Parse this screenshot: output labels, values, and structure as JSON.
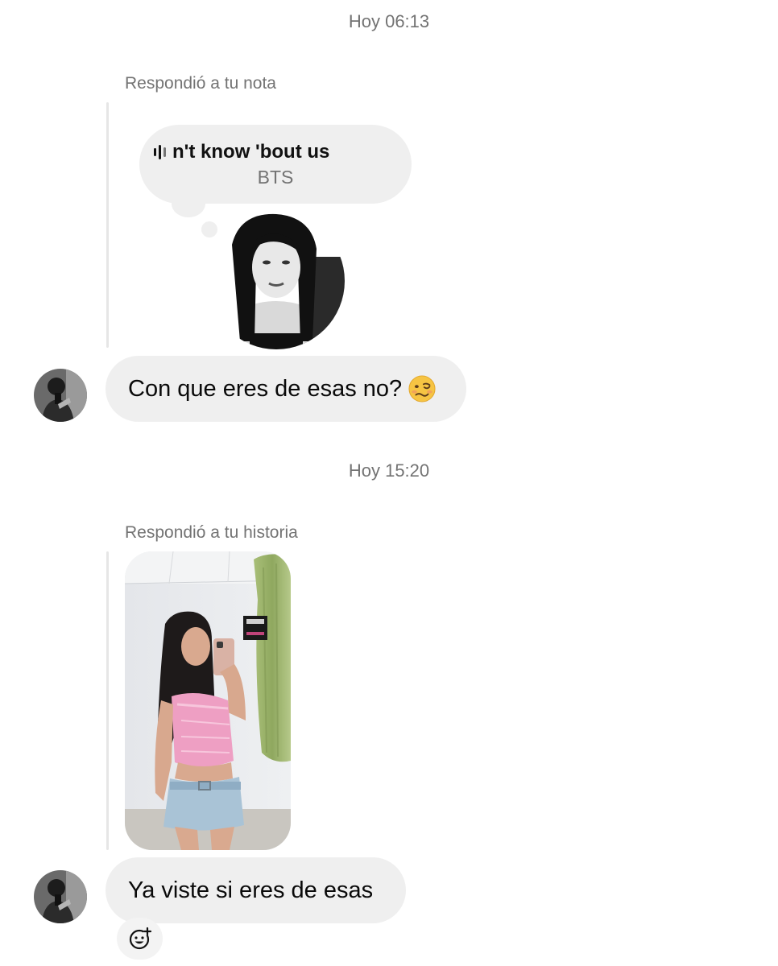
{
  "conversation": {
    "section1": {
      "timestamp": "Hoy 06:13",
      "reply_label": "Respondió a tu nota",
      "note": {
        "song_title": "n't know 'bout us",
        "artist": "BTS",
        "icon": "equalizer-icon"
      },
      "message": "Con que eres de esas no?",
      "message_emoji": "woozy-face-emoji"
    },
    "section2": {
      "timestamp": "Hoy 15:20",
      "reply_label": "Respondió a tu historia",
      "message": "Ya viste si eres de esas"
    },
    "reaction_button_icon": "add-reaction-icon"
  },
  "colors": {
    "bubble_background": "#efefef",
    "meta_text": "#737373",
    "reply_line": "#e6e6e6",
    "text": "#0a0a0a"
  }
}
